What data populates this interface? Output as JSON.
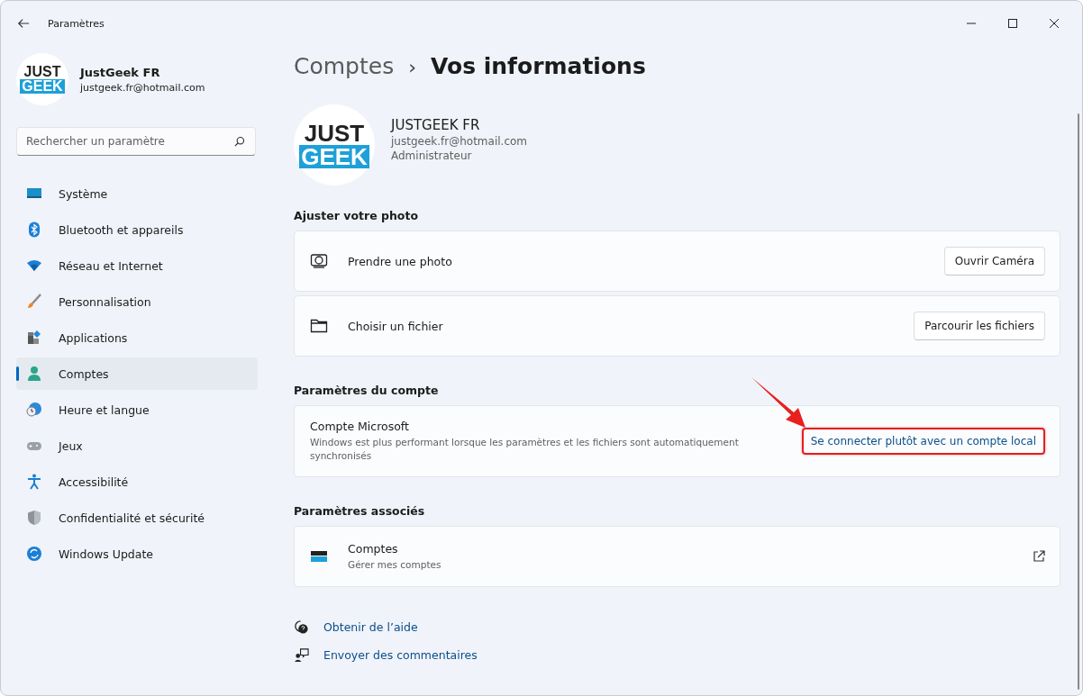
{
  "window": {
    "title": "Paramètres"
  },
  "sidebar": {
    "user": {
      "logo": [
        "JUST",
        "GEEK"
      ],
      "name": "JustGeek FR",
      "email": "justgeek.fr@hotmail.com"
    },
    "search": {
      "placeholder": "Rechercher un paramètre"
    },
    "items": [
      {
        "label": "Système",
        "kind": "display",
        "selected": false
      },
      {
        "label": "Bluetooth et appareils",
        "kind": "bluetooth",
        "selected": false
      },
      {
        "label": "Réseau et Internet",
        "kind": "wifi",
        "selected": false
      },
      {
        "label": "Personnalisation",
        "kind": "brush",
        "selected": false
      },
      {
        "label": "Applications",
        "kind": "apps",
        "selected": false
      },
      {
        "label": "Comptes",
        "kind": "person",
        "selected": true
      },
      {
        "label": "Heure et langue",
        "kind": "clock",
        "selected": false
      },
      {
        "label": "Jeux",
        "kind": "gamepad",
        "selected": false
      },
      {
        "label": "Accessibilité",
        "kind": "accessibility",
        "selected": false
      },
      {
        "label": "Confidentialité et sécurité",
        "kind": "shield",
        "selected": false
      },
      {
        "label": "Windows Update",
        "kind": "update",
        "selected": false
      }
    ]
  },
  "breadcrumb": {
    "parent": "Comptes",
    "separator": "›",
    "current": "Vos informations"
  },
  "profile": {
    "logo": [
      "JUST",
      "GEEK"
    ],
    "name": "JUSTGEEK FR",
    "email": "justgeek.fr@hotmail.com",
    "role": "Administrateur"
  },
  "sections": [
    {
      "heading": "Ajuster votre photo",
      "cards": [
        {
          "kind": "camera",
          "title": "Prendre une photo",
          "button": "Ouvrir Caméra"
        },
        {
          "kind": "folder",
          "title": "Choisir un fichier",
          "button": "Parcourir les fichiers"
        }
      ]
    },
    {
      "heading": "Paramètres du compte",
      "cards": [
        {
          "kind": "account",
          "title": "Compte Microsoft",
          "description": "Windows est plus performant lorsque les paramètres et les fichiers sont automatiquement synchronisés",
          "link": "Se connecter plutôt avec un compte local",
          "highlighted": true
        }
      ]
    },
    {
      "heading": "Paramètres associés",
      "cards": [
        {
          "kind": "related",
          "title": "Comptes",
          "description": "Gérer mes comptes"
        }
      ]
    }
  ],
  "footer_links": [
    {
      "kind": "help",
      "label": "Obtenir de l’aide"
    },
    {
      "kind": "feedback",
      "label": "Envoyer des commentaires"
    }
  ]
}
